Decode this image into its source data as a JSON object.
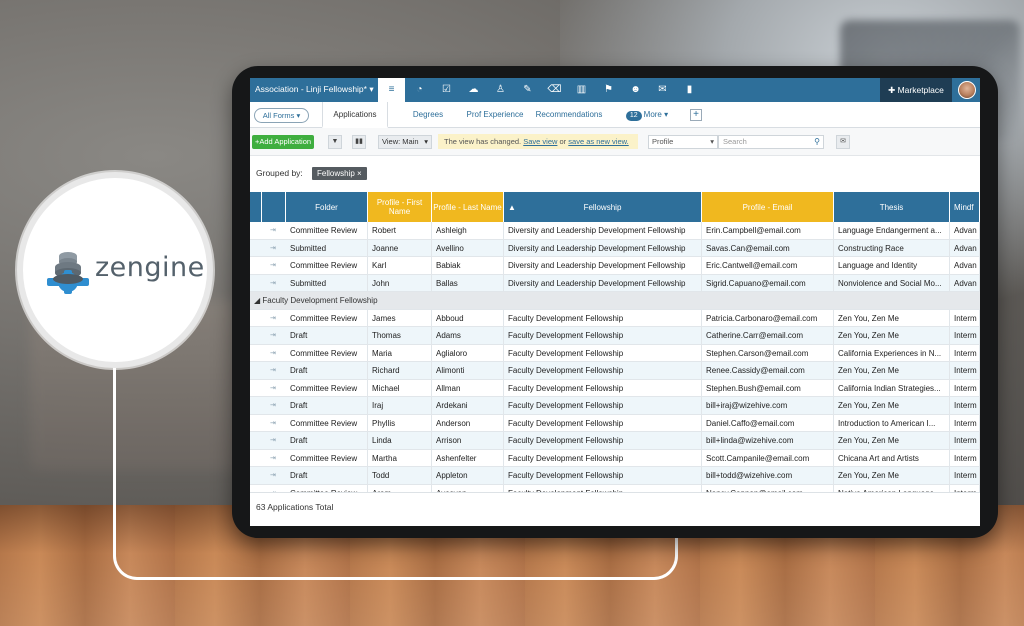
{
  "brand": {
    "name": "zengine"
  },
  "topnav": {
    "workspace_title": "Association - Linji Fellowship* ▾",
    "marketplace_label": "Marketplace"
  },
  "tabs": {
    "all_forms": "All Forms ▾",
    "items": [
      "Applications",
      "Degrees",
      "Prof Experience",
      "Recommendations"
    ],
    "more_count": "12",
    "more_label": "More ▾",
    "add": "+"
  },
  "toolbar": {
    "add_application": "+Add Application",
    "view": "View: Main",
    "changed_note_prefix": "The view has changed.",
    "save_view": "Save view",
    "or": "or",
    "save_as_new": "save as new view.",
    "profile_select": "Profile",
    "search_placeholder": "Search"
  },
  "grouping": {
    "label": "Grouped by:",
    "chip": "Fellowship"
  },
  "table": {
    "columns": [
      "Folder",
      "Profile - First Name",
      "Profile - Last Name",
      "Fellowship",
      "Profile - Email",
      "Thesis",
      "Mindf"
    ],
    "group_label": "Faculty Development Fellowship",
    "rows_a": [
      [
        "Committee Review",
        "Robert",
        "Ashleigh",
        "Diversity and Leadership Development Fellowship",
        "Erin.Campbell@email.com",
        "Language Endangerment a...",
        "Advan"
      ],
      [
        "Submitted",
        "Joanne",
        "Avellino",
        "Diversity and Leadership Development Fellowship",
        "Savas.Can@email.com",
        "Constructing Race",
        "Advan"
      ],
      [
        "Committee Review",
        "Karl",
        "Babiak",
        "Diversity and Leadership Development Fellowship",
        "Eric.Cantwell@email.com",
        "Language and Identity",
        "Advan"
      ],
      [
        "Submitted",
        "John",
        "Ballas",
        "Diversity and Leadership Development Fellowship",
        "Sigrid.Capuano@email.com",
        "Nonviolence and Social Mo...",
        "Advan"
      ]
    ],
    "rows_b": [
      [
        "Committee Review",
        "James",
        "Abboud",
        "Faculty Development Fellowship",
        "Patricia.Carbonaro@email.com",
        "Zen You, Zen Me",
        "Interm"
      ],
      [
        "Draft",
        "Thomas",
        "Adams",
        "Faculty Development Fellowship",
        "Catherine.Carr@email.com",
        "Zen You, Zen Me",
        "Interm"
      ],
      [
        "Committee Review",
        "Maria",
        "Aglialoro",
        "Faculty Development Fellowship",
        "Stephen.Carson@email.com",
        "California Experiences in N...",
        "Interm"
      ],
      [
        "Draft",
        "Richard",
        "Alimonti",
        "Faculty Development Fellowship",
        "Renee.Cassidy@email.com",
        "Zen You, Zen Me",
        "Interm"
      ],
      [
        "Committee Review",
        "Michael",
        "Allman",
        "Faculty Development Fellowship",
        "Stephen.Bush@email.com",
        "California Indian Strategies...",
        "Interm"
      ],
      [
        "Draft",
        "Iraj",
        "Ardekani",
        "Faculty Development Fellowship",
        "bill+iraj@wizehive.com",
        "Zen You, Zen Me",
        "Interm"
      ],
      [
        "Committee Review",
        "Phyllis",
        "Anderson",
        "Faculty Development Fellowship",
        "Daniel.Caffo@email.com",
        "Introduction to American I...",
        "Interm"
      ],
      [
        "Draft",
        "Linda",
        "Arrison",
        "Faculty Development Fellowship",
        "bill+linda@wizehive.com",
        "Zen You, Zen Me",
        "Interm"
      ],
      [
        "Committee Review",
        "Martha",
        "Ashenfelter",
        "Faculty Development Fellowship",
        "Scott.Campanile@email.com",
        "Chicana Art and Artists",
        "Interm"
      ],
      [
        "Draft",
        "Todd",
        "Appleton",
        "Faculty Development Fellowship",
        "bill+todd@wizehive.com",
        "Zen You, Zen Me",
        "Interm"
      ],
      [
        "Committee Review",
        "Aram",
        "Avesyan",
        "Faculty Development Fellowship",
        "Nancy.Cannon@email.com",
        "Native American Language...",
        "Interm"
      ]
    ],
    "total": "63 Applications Total"
  },
  "colors": {
    "nav_blue": "#2e6f9a",
    "header_yellow": "#f0b81f",
    "add_green": "#3fae3f"
  }
}
